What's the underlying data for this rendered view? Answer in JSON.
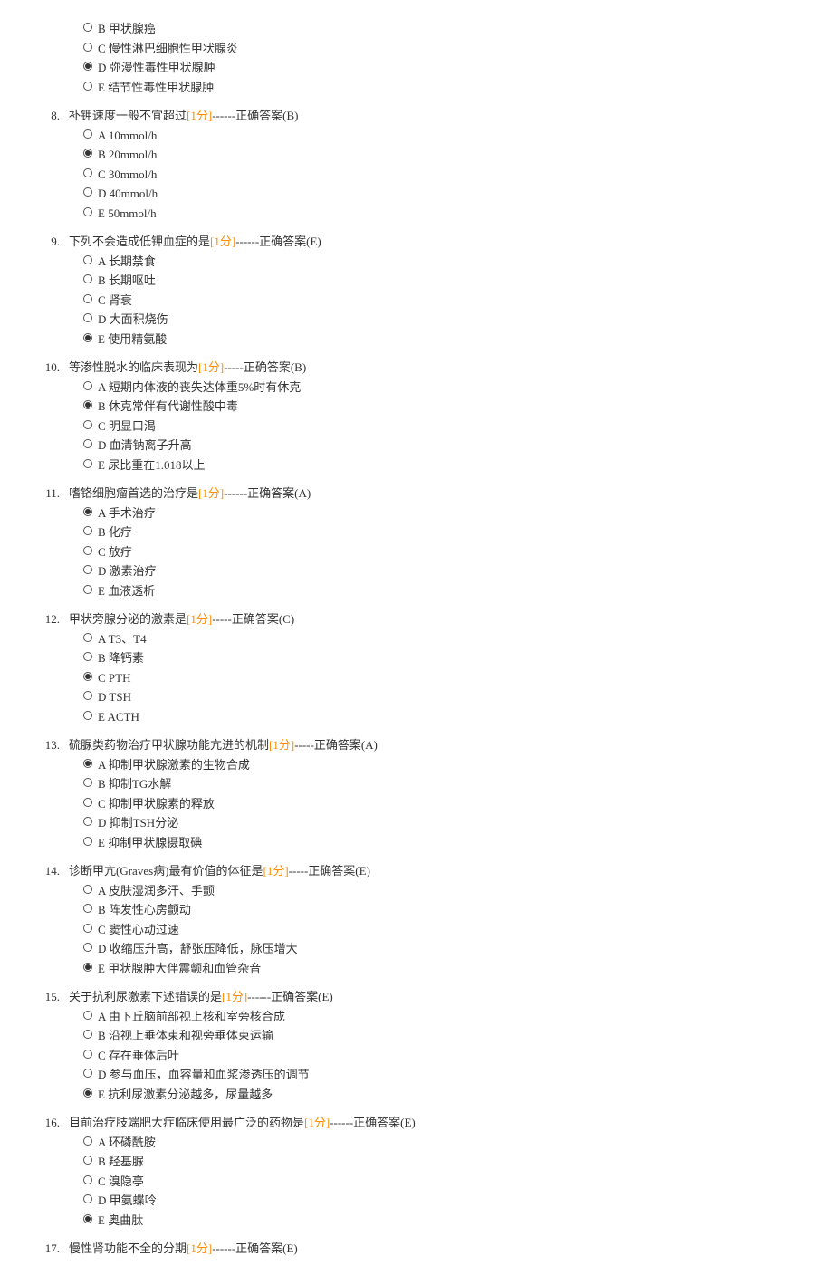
{
  "score_text": "[1分]",
  "questions": [
    {
      "num": "",
      "text": "",
      "answer": "",
      "options": [
        {
          "key": "B",
          "label": "甲状腺癌",
          "selected": false
        },
        {
          "key": "C",
          "label": "慢性淋巴细胞性甲状腺炎",
          "selected": false
        },
        {
          "key": "D",
          "label": "弥漫性毒性甲状腺肿",
          "selected": true
        },
        {
          "key": "E",
          "label": "结节性毒性甲状腺肿",
          "selected": false
        }
      ]
    },
    {
      "num": "8.",
      "text": "补钾速度一般不宜超过",
      "answer": "------正确答案(B)",
      "options": [
        {
          "key": "A",
          "label": "10mmol/h",
          "selected": false
        },
        {
          "key": "B",
          "label": "20mmol/h",
          "selected": true
        },
        {
          "key": "C",
          "label": "30mmol/h",
          "selected": false
        },
        {
          "key": "D",
          "label": "40mmol/h",
          "selected": false
        },
        {
          "key": "E",
          "label": "50mmol/h",
          "selected": false
        }
      ]
    },
    {
      "num": "9.",
      "text": "下列不会造成低钾血症的是",
      "answer": "------正确答案(E)",
      "options": [
        {
          "key": "A",
          "label": "长期禁食",
          "selected": false
        },
        {
          "key": "B",
          "label": "长期呕吐",
          "selected": false
        },
        {
          "key": "C",
          "label": "肾衰",
          "selected": false
        },
        {
          "key": "D",
          "label": "大面积烧伤",
          "selected": false
        },
        {
          "key": "E",
          "label": "使用精氨酸",
          "selected": true
        }
      ]
    },
    {
      "num": "10.",
      "text": "等渗性脱水的临床表现为",
      "answer": "-----正确答案(B)",
      "options": [
        {
          "key": "A",
          "label": "短期内体液的丧失达体重5%时有休克",
          "selected": false
        },
        {
          "key": "B",
          "label": "休克常伴有代谢性酸中毒",
          "selected": true
        },
        {
          "key": "C",
          "label": "明显口渴",
          "selected": false
        },
        {
          "key": "D",
          "label": "血清钠离子升高",
          "selected": false
        },
        {
          "key": "E",
          "label": "尿比重在1.018以上",
          "selected": false
        }
      ]
    },
    {
      "num": "11.",
      "text": "嗜铬细胞瘤首选的治疗是",
      "answer": "------正确答案(A)",
      "options": [
        {
          "key": "A",
          "label": "手术治疗",
          "selected": true
        },
        {
          "key": "B",
          "label": "化疗",
          "selected": false
        },
        {
          "key": "C",
          "label": "放疗",
          "selected": false
        },
        {
          "key": "D",
          "label": "激素治疗",
          "selected": false
        },
        {
          "key": "E",
          "label": "血液透析",
          "selected": false
        }
      ]
    },
    {
      "num": "12.",
      "text": "甲状旁腺分泌的激素是",
      "answer": "-----正确答案(C)",
      "options": [
        {
          "key": "A",
          "label": "T3、T4",
          "selected": false
        },
        {
          "key": "B",
          "label": "降钙素",
          "selected": false
        },
        {
          "key": "C",
          "label": "PTH",
          "selected": true
        },
        {
          "key": "D",
          "label": "TSH",
          "selected": false
        },
        {
          "key": "E",
          "label": "ACTH",
          "selected": false
        }
      ]
    },
    {
      "num": "13.",
      "text": "硫脲类药物治疗甲状腺功能亢进的机制",
      "answer": "-----正确答案(A)",
      "options": [
        {
          "key": "A",
          "label": "抑制甲状腺激素的生物合成",
          "selected": true
        },
        {
          "key": "B",
          "label": "抑制TG水解",
          "selected": false
        },
        {
          "key": "C",
          "label": "抑制甲状腺素的释放",
          "selected": false
        },
        {
          "key": "D",
          "label": "抑制TSH分泌",
          "selected": false
        },
        {
          "key": "E",
          "label": "抑制甲状腺摄取碘",
          "selected": false
        }
      ]
    },
    {
      "num": "14.",
      "text": "诊断甲亢(Graves病)最有价值的体征是",
      "answer": "-----正确答案(E)",
      "options": [
        {
          "key": "A",
          "label": "皮肤湿润多汗、手颤",
          "selected": false
        },
        {
          "key": "B",
          "label": "阵发性心房颤动",
          "selected": false
        },
        {
          "key": "C",
          "label": "窦性心动过速",
          "selected": false
        },
        {
          "key": "D",
          "label": "收缩压升高，舒张压降低，脉压增大",
          "selected": false
        },
        {
          "key": "E",
          "label": "甲状腺肿大伴震颤和血管杂音",
          "selected": true
        }
      ]
    },
    {
      "num": "15.",
      "text": "关于抗利尿激素下述错误的是",
      "answer": "------正确答案(E)",
      "options": [
        {
          "key": "A",
          "label": "由下丘脑前部视上核和室旁核合成",
          "selected": false
        },
        {
          "key": "B",
          "label": "沿视上垂体束和视旁垂体束运输",
          "selected": false
        },
        {
          "key": "C",
          "label": "存在垂体后叶",
          "selected": false
        },
        {
          "key": "D",
          "label": "参与血压，血容量和血浆渗透压的调节",
          "selected": false
        },
        {
          "key": "E",
          "label": "抗利尿激素分泌越多，尿量越多",
          "selected": true
        }
      ]
    },
    {
      "num": "16.",
      "text": "目前治疗肢端肥大症临床使用最广泛的药物是",
      "answer": "------正确答案(E)",
      "options": [
        {
          "key": "A",
          "label": "环磷酰胺",
          "selected": false
        },
        {
          "key": "B",
          "label": "羟基脲",
          "selected": false
        },
        {
          "key": "C",
          "label": "溴隐亭",
          "selected": false
        },
        {
          "key": "D",
          "label": "甲氨蝶呤",
          "selected": false
        },
        {
          "key": "E",
          "label": "奥曲肽",
          "selected": true
        }
      ]
    },
    {
      "num": "17.",
      "text": "慢性肾功能不全的分期",
      "answer": "------正确答案(E)",
      "options": []
    }
  ]
}
